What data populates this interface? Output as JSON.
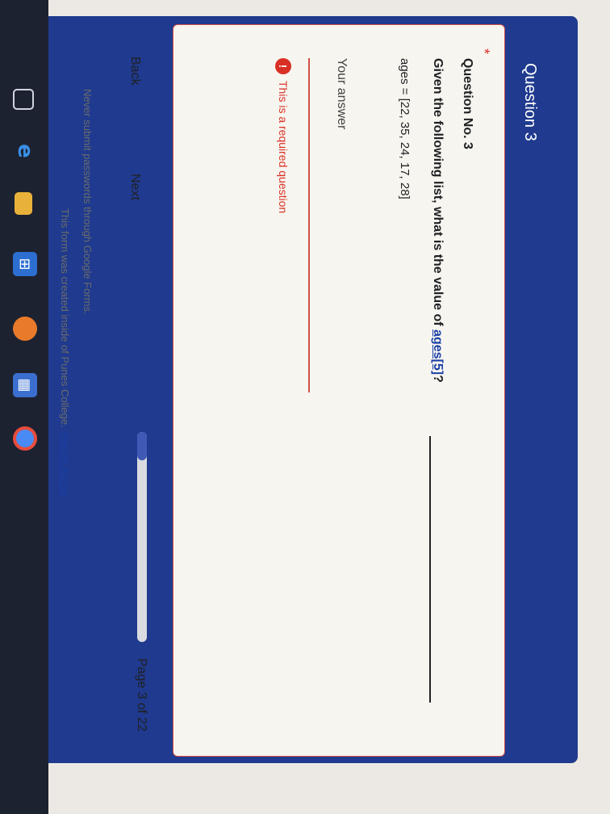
{
  "header": {
    "title": "Question 3"
  },
  "question": {
    "required_marker": "*",
    "number": "Question No. 3",
    "text_before": "Given the following list, what is the value of ",
    "text_highlight": "ages[5]",
    "text_after": "?",
    "list": "ages = [22, 35, 24, 17, 28]"
  },
  "answer": {
    "label": "Your answer",
    "value": "",
    "error": "This is a required question",
    "error_icon": "!"
  },
  "navigation": {
    "back_label": "Back",
    "next_label": "Next",
    "progress_fraction": 0.136,
    "page_count": "Page 3 of 22"
  },
  "footer": {
    "warning": "Never submit passwords through Google Forms.",
    "created_text": "This form was created inside of Punes College.",
    "report_link": "Report Abuse"
  },
  "colors": {
    "header": "#1f3a8e",
    "error": "#d93025",
    "progress": "#3f59b5"
  },
  "taskbar_icons": [
    "task-view-icon",
    "edge-icon",
    "file-explorer-icon",
    "store-icon",
    "firefox-icon",
    "calendar-icon",
    "chrome-icon"
  ]
}
